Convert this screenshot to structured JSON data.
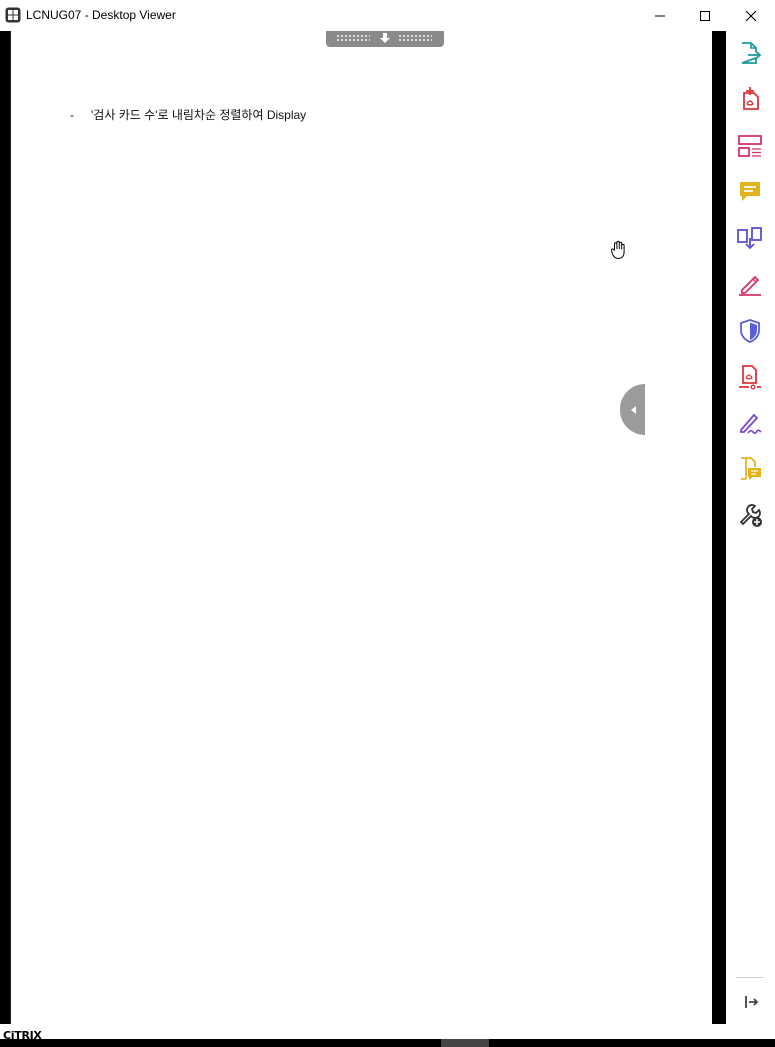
{
  "window": {
    "title": "LCNUG07 - Desktop Viewer",
    "app_icon": "citrix-window-icon",
    "controls": [
      "minimize-icon",
      "maximize-icon",
      "close-icon"
    ]
  },
  "citrix_toolbar": {
    "icon": "download-arrow-icon"
  },
  "document": {
    "bullet_marker": "-",
    "bullet_text": "'검사 카드 수'로 내림차순 정렬하여 Display"
  },
  "tool_pane": {
    "tools": [
      {
        "icon": "export-pdf-icon",
        "color": "#1a9a9a"
      },
      {
        "icon": "create-pdf-icon",
        "color": "#e0343c"
      },
      {
        "icon": "edit-pdf-icon",
        "color": "#d6336c"
      },
      {
        "icon": "comment-icon",
        "color": "#e3b21c"
      },
      {
        "icon": "combine-files-icon",
        "color": "#5a4fd6"
      },
      {
        "icon": "fill-sign-icon",
        "color": "#d6336c"
      },
      {
        "icon": "protect-icon",
        "color": "#5a5fd6"
      },
      {
        "icon": "pdf-redact-icon",
        "color": "#e0343c"
      },
      {
        "icon": "send-for-signature-icon",
        "color": "#7b45d6"
      },
      {
        "icon": "send-for-comments-icon",
        "color": "#e3b21c"
      },
      {
        "icon": "more-tools-icon",
        "color": "#333333"
      }
    ],
    "toggle_icon": "collapse-pane-icon"
  },
  "footer": {
    "brand": "CiTRIX"
  }
}
